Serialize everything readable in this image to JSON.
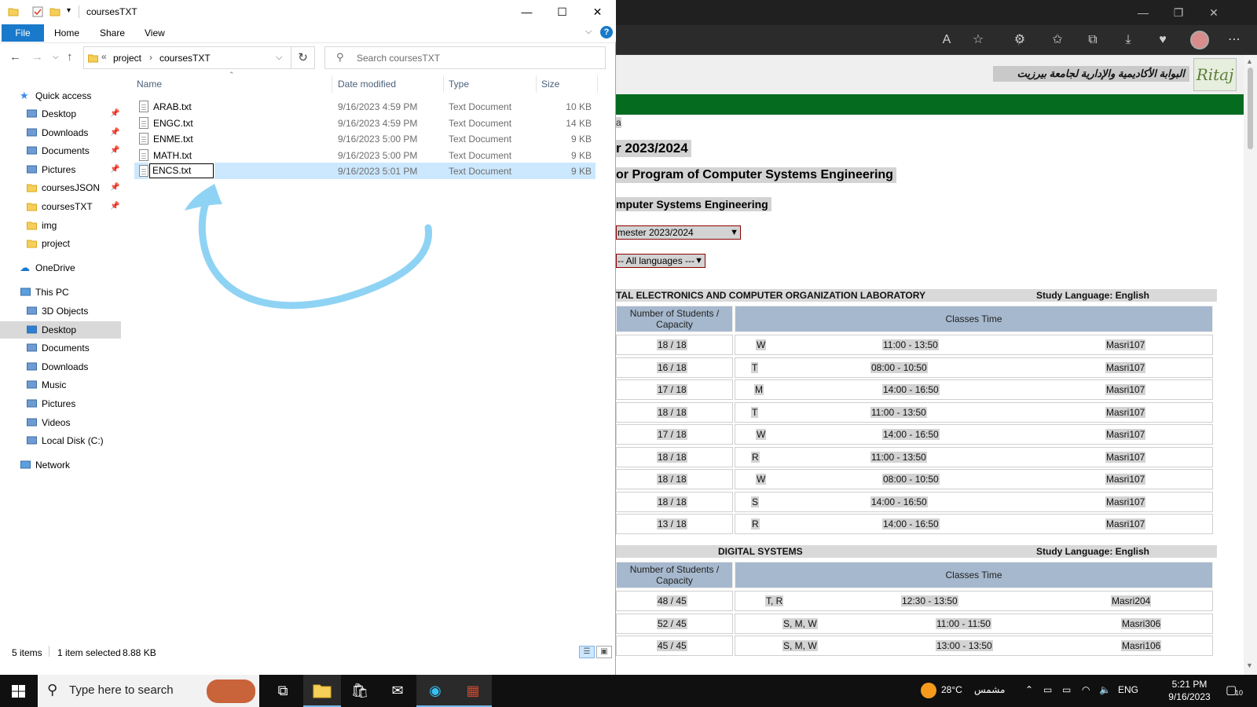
{
  "explorer": {
    "title": "coursesTXT",
    "ribbon_tabs": {
      "file": "File",
      "home": "Home",
      "share": "Share",
      "view": "View"
    },
    "breadcrumb": {
      "overflow": "«",
      "parts": [
        "project",
        "coursesTXT"
      ],
      "sep": "›"
    },
    "search_placeholder": "Search coursesTXT",
    "columns": {
      "name": "Name",
      "date": "Date modified",
      "type": "Type",
      "size": "Size"
    },
    "nav": {
      "quick_access": "Quick access",
      "quick_items": [
        "Desktop",
        "Downloads",
        "Documents",
        "Pictures",
        "coursesJSON",
        "coursesTXT",
        "img",
        "project"
      ],
      "onedrive": "OneDrive",
      "this_pc": "This PC",
      "pc_items": [
        "3D Objects",
        "Desktop",
        "Documents",
        "Downloads",
        "Music",
        "Pictures",
        "Videos",
        "Local Disk (C:)"
      ],
      "network": "Network"
    },
    "files": [
      {
        "name": "ARAB.txt",
        "date": "9/16/2023 4:59 PM",
        "type": "Text Document",
        "size": "10 KB"
      },
      {
        "name": "ENGC.txt",
        "date": "9/16/2023 4:59 PM",
        "type": "Text Document",
        "size": "14 KB"
      },
      {
        "name": "ENME.txt",
        "date": "9/16/2023 5:00 PM",
        "type": "Text Document",
        "size": "9 KB"
      },
      {
        "name": "MATH.txt",
        "date": "9/16/2023 5:00 PM",
        "type": "Text Document",
        "size": "9 KB"
      },
      {
        "name": "ENCS.txt",
        "date": "9/16/2023 5:01 PM",
        "type": "Text Document",
        "size": "9 KB"
      }
    ],
    "selected_file_index": 4,
    "status": {
      "items": "5 items",
      "selected": "1 item selected",
      "size": "8.88 KB"
    }
  },
  "browser": {
    "header_arabic": "البوابة الأكاديمية والإدارية لجامعة بيرزيت",
    "logo_text": "Ritaj",
    "fragment_a": "a",
    "term_title": "r 2023/2024",
    "program_title": "or Program of Computer Systems Engineering",
    "major_title": "mputer Systems Engineering",
    "semester_select": "mester 2023/2024",
    "language_select": "-- All languages ---",
    "courses": [
      {
        "name": "TAL ELECTRONICS AND COMPUTER ORGANIZATION LABORATORY",
        "lang": "Study Language: English",
        "header_students": "Number of Students / Capacity",
        "header_time": "Classes Time",
        "rows": [
          {
            "cap": "18 / 18",
            "day": "W",
            "time": "11:00 - 13:50",
            "room": "Masri107"
          },
          {
            "cap": "16 / 18",
            "day": "T",
            "time": "08:00 - 10:50",
            "room": "Masri107"
          },
          {
            "cap": "17 / 18",
            "day": "M",
            "time": "14:00 - 16:50",
            "room": "Masri107"
          },
          {
            "cap": "18 / 18",
            "day": "T",
            "time": "11:00 - 13:50",
            "room": "Masri107"
          },
          {
            "cap": "17 / 18",
            "day": "W",
            "time": "14:00 - 16:50",
            "room": "Masri107"
          },
          {
            "cap": "18 / 18",
            "day": "R",
            "time": "11:00 - 13:50",
            "room": "Masri107"
          },
          {
            "cap": "18 / 18",
            "day": "W",
            "time": "08:00 - 10:50",
            "room": "Masri107"
          },
          {
            "cap": "18 / 18",
            "day": "S",
            "time": "14:00 - 16:50",
            "room": "Masri107"
          },
          {
            "cap": "13 / 18",
            "day": "R",
            "time": "14:00 - 16:50",
            "room": "Masri107"
          }
        ]
      },
      {
        "name": "DIGITAL SYSTEMS",
        "lang": "Study Language: English",
        "header_students": "Number of Students / Capacity",
        "header_time": "Classes Time",
        "rows": [
          {
            "cap": "48 / 45",
            "day": "T, R",
            "time": "12:30 - 13:50",
            "room": "Masri204"
          },
          {
            "cap": "52 / 45",
            "day": "S, M, W",
            "time": "11:00 - 11:50",
            "room": "Masri306"
          },
          {
            "cap": "45 / 45",
            "day": "S, M, W",
            "time": "13:00 - 13:50",
            "room": "Masri106"
          }
        ]
      }
    ]
  },
  "taskbar": {
    "search_placeholder": "Type here to search",
    "weather_temp": "28°C",
    "weather_text": "مشمس",
    "lang": "ENG",
    "time": "5:21 PM",
    "date": "9/16/2023",
    "notification_count": "10"
  },
  "colors": {
    "ritaj_green": "#046b1f",
    "table_header": "#a6b8cd",
    "selection": "#cce8ff",
    "file_tab": "#1979ca",
    "arrow_annotation": "#8fd3f4"
  }
}
